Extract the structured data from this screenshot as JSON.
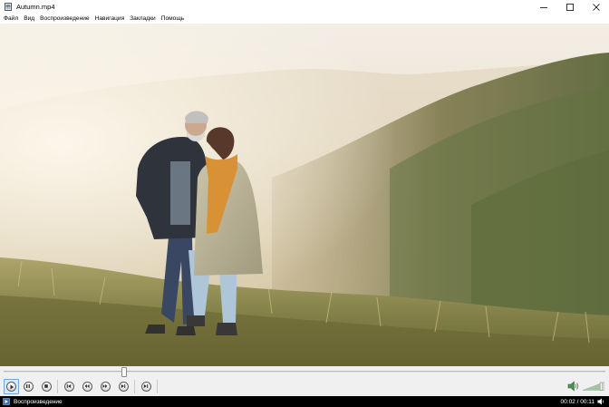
{
  "window": {
    "title": "Autumn.mp4"
  },
  "menu": [
    {
      "label": "Файл"
    },
    {
      "label": "Вид"
    },
    {
      "label": "Воспроизведение"
    },
    {
      "label": "Навигация"
    },
    {
      "label": "Закладки"
    },
    {
      "label": "Помощь"
    }
  ],
  "player": {
    "seek_fraction": 0.2,
    "volume_fraction": 0.85
  },
  "status": {
    "state": "Воспроизведение",
    "time": "00:02 / 00:11"
  },
  "colors": {
    "accent": "#76a6d8",
    "status_bg": "#000000"
  },
  "icons": {
    "app": "video-file-icon",
    "minimize": "minimize-icon",
    "maximize": "maximize-icon",
    "close": "close-icon"
  }
}
